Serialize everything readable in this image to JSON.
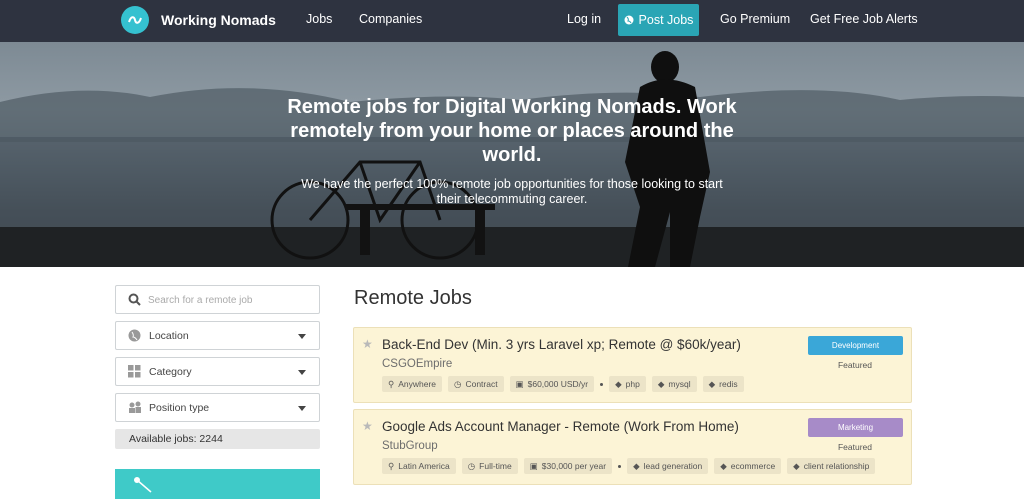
{
  "nav": {
    "brand": "Working Nomads",
    "links": [
      "Jobs",
      "Companies"
    ],
    "login": "Log in",
    "post_jobs": "Post Jobs",
    "go_premium": "Go Premium",
    "job_alerts": "Get Free Job Alerts",
    "accent": "#2aa5b5"
  },
  "hero": {
    "title": "Remote jobs for Digital Working Nomads. Work remotely from your home or places around the world.",
    "subtitle": "We have the perfect 100% remote job opportunities for those looking to start their telecommuting career."
  },
  "sidebar": {
    "search_placeholder": "Search for a remote job",
    "location": "Location",
    "category": "Category",
    "position_type": "Position type",
    "available_jobs": "Available jobs: 2244"
  },
  "main": {
    "title": "Remote Jobs",
    "jobs": [
      {
        "title": "Back-End Dev (Min. 3 yrs Laravel xp; Remote @ $60k/year)",
        "company": "CSGOEmpire",
        "location": "Anywhere",
        "type": "Contract",
        "salary": "$60,000 USD/yr",
        "tags": [
          "php",
          "mysql",
          "redis"
        ],
        "category": "Development",
        "category_color": "#3aa7d8",
        "featured": "Featured"
      },
      {
        "title": "Google Ads Account Manager - Remote (Work From Home)",
        "company": "StubGroup",
        "location": "Latin America",
        "type": "Full-time",
        "salary": "$30,000 per year",
        "tags": [
          "lead generation",
          "ecommerce",
          "client relationship"
        ],
        "category": "Marketing",
        "category_color": "#a78bc8",
        "featured": "Featured"
      }
    ]
  }
}
